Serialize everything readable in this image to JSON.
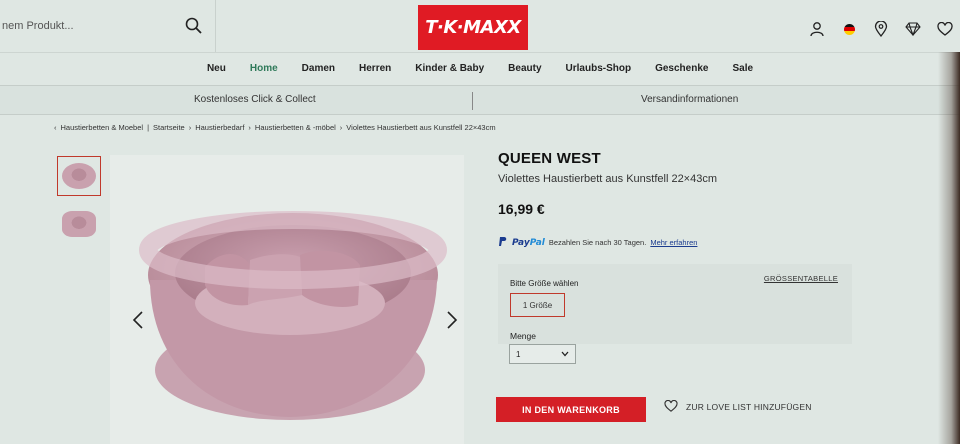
{
  "header": {
    "search_placeholder": "nem Produkt...",
    "logo_text": "T·K·MAXX",
    "icons": [
      "account-icon",
      "language-flag-de-icon",
      "store-locator-icon",
      "diamond-icon",
      "wishlist-heart-icon"
    ]
  },
  "nav": {
    "items": [
      {
        "label": "Neu"
      },
      {
        "label": "Home"
      },
      {
        "label": "Damen"
      },
      {
        "label": "Herren"
      },
      {
        "label": "Kinder & Baby"
      },
      {
        "label": "Beauty"
      },
      {
        "label": "Urlaubs-Shop"
      },
      {
        "label": "Geschenke"
      },
      {
        "label": "Sale"
      }
    ],
    "active": "Home",
    "active_color": "#2f7a5a"
  },
  "service": {
    "left": "Kostenloses Click & Collect",
    "right": "Versandinformationen"
  },
  "breadcrumb": {
    "back": "Haustierbetten & Moebel",
    "items": [
      "Startseite",
      "Haustierbedarf",
      "Haustierbetten & -möbel",
      "Violettes Haustierbett aus Kunstfell 22×43cm"
    ]
  },
  "product": {
    "brand": "QUEEN WEST",
    "title": "Violettes Haustierbett aus Kunstfell 22×43cm",
    "price": "16,99 €",
    "paypal": {
      "logo_a": "Pay",
      "logo_b": "Pal",
      "text": "Bezahlen Sie nach 30 Tagen.",
      "link": "Mehr erfahren"
    },
    "size": {
      "label": "Bitte Größe wählen",
      "chart_link": "GRÖSSENTABELLE",
      "options": [
        "1 Größe"
      ],
      "selected": "1 Größe"
    },
    "quantity": {
      "label": "Menge",
      "value": "1"
    },
    "add_to_cart": "IN DEN WARENKORB",
    "love_list": "ZUR LOVE LIST HINZUFÜGEN"
  },
  "colors": {
    "brand_red": "#e01b24",
    "button_red": "#d41f26",
    "accent_green": "#2f7a5a",
    "product_pink": "#c9a1ae"
  }
}
